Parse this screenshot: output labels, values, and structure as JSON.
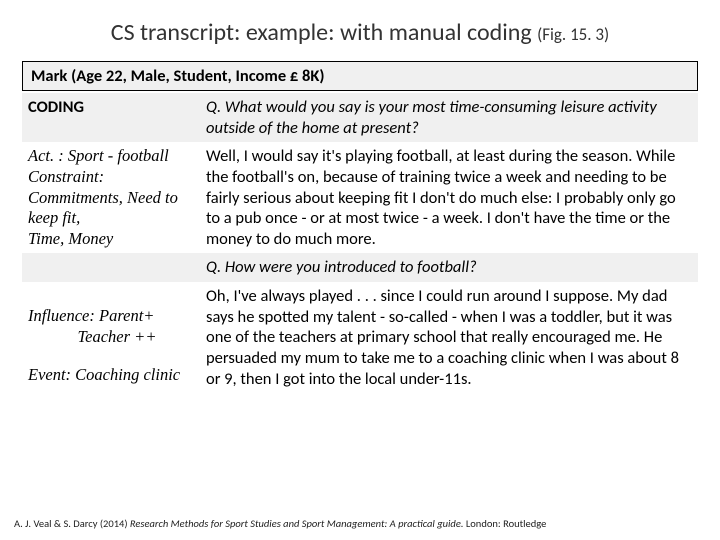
{
  "title_main": "CS transcript: example: with manual coding ",
  "title_fig": "(Fig. 15. 3)",
  "subject": "Mark (Age 22, Male, Student, Income £ 8K)",
  "coding_header": "CODING",
  "q1": "Q. What would you say is your most time-consuming leisure activity outside of the home at present?",
  "codes1": "Act. : Sport - football\nConstraint: Commitments, Need to keep fit,\nTime,  Money",
  "a1": "Well, I would say it's playing football, at least during the season.  While the football's on, because of training twice a week and needing to be fairly serious about keeping fit I don't do much else: I probably only go to a pub once - or at most twice - a week. I don't have the time or the money to do much more.",
  "q2": "Q. How were you introduced to football?",
  "codes2a": "Influence: Parent+\n            Teacher ++",
  "codes2b": "Event: Coaching clinic",
  "a2": "Oh, I've always played . . . since I could run around I suppose. My dad says he spotted my talent - so-called - when I was a toddler, but it was one of the teachers at primary school that really encouraged me. He persuaded my mum to take me to a coaching clinic when I was about 8 or 9, then I got into the local under-11s.",
  "footer_pre": "A. J. Veal & S. Darcy (2014) ",
  "footer_title": "Research Methods for Sport Studies and Sport Management: A practical guide.",
  "footer_post": " London: Routledge"
}
